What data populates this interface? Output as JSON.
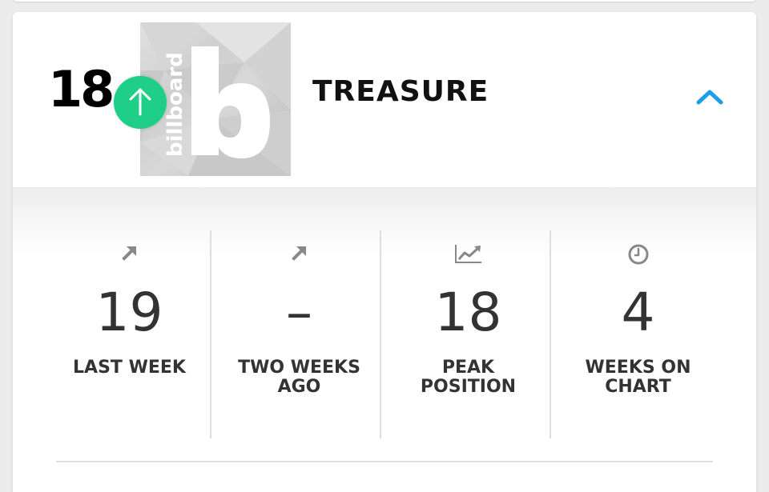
{
  "chart_entry": {
    "rank": "18",
    "trend": "up",
    "artist": "TREASURE",
    "cover_logo_text": "billboard",
    "cover_big_letter": "b"
  },
  "stats": [
    {
      "icon": "arrow-up-right-icon",
      "value": "19",
      "label": "LAST WEEK"
    },
    {
      "icon": "arrow-up-right-icon",
      "value": "–",
      "label": "TWO WEEKS AGO"
    },
    {
      "icon": "trend-chart-icon",
      "value": "18",
      "label": "PEAK POSITION"
    },
    {
      "icon": "clock-icon",
      "value": "4",
      "label": "WEEKS ON CHART"
    }
  ],
  "colors": {
    "trend_up": "#1fcf87",
    "accent": "#1e9ee6",
    "text": "#333333"
  }
}
